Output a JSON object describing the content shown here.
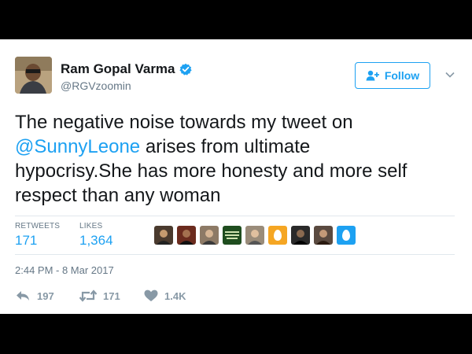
{
  "author": {
    "name": "Ram Gopal Varma",
    "handle": "@RGVzoomin"
  },
  "follow_label": "Follow",
  "tweet": {
    "line1": "The negative noise towards my tweet on",
    "mention": "@SunnyLeone",
    "line2_rest": " arises from ultimate",
    "line3": "hypocrisy.She has more honesty and more self",
    "line4": "respect than any woman"
  },
  "stats": {
    "retweets_label": "RETWEETS",
    "retweets_value": "171",
    "likes_label": "LIKES",
    "likes_value": "1,364"
  },
  "likers": [
    {
      "icon": "photo-avatar",
      "color": "#4a3a2e"
    },
    {
      "icon": "photo-avatar",
      "color": "#6b2b1e"
    },
    {
      "icon": "photo-avatar",
      "color": "#8d7a66"
    },
    {
      "icon": "text-card-avatar",
      "color": "#1f4d1f"
    },
    {
      "icon": "photo-avatar",
      "color": "#9a8c7a"
    },
    {
      "icon": "egg-avatar",
      "color": "#f5a623"
    },
    {
      "icon": "photo-avatar",
      "color": "#2a2a2a"
    },
    {
      "icon": "photo-avatar",
      "color": "#5a4a40"
    },
    {
      "icon": "egg-avatar",
      "color": "#1da1f2"
    }
  ],
  "timestamp": "2:44 PM - 8 Mar 2017",
  "actions": {
    "reply_count": "197",
    "retweet_count": "171",
    "like_count": "1.4K"
  },
  "colors": {
    "brand": "#1da1f2",
    "text": "#14171a",
    "muted": "#657786",
    "icon": "#8899a6"
  }
}
